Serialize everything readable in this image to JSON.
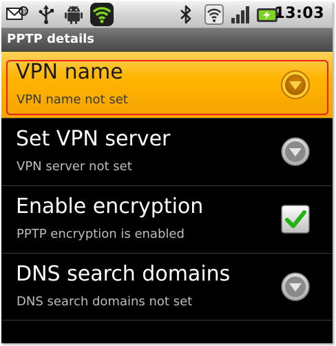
{
  "status_bar": {
    "time": "13:03",
    "icons": [
      "mail-sync-icon",
      "usb-icon",
      "android-debug-icon",
      "wifi-icon",
      "bluetooth-icon",
      "wifi-signal-icon",
      "cell-signal-icon",
      "battery-charging-icon"
    ]
  },
  "header": {
    "title": "PPTP details"
  },
  "prefs": [
    {
      "title": "VPN name",
      "summary": "VPN name not set",
      "control": "dropdown",
      "selected": true
    },
    {
      "title": "Set VPN server",
      "summary": "VPN server not set",
      "control": "dropdown",
      "selected": false
    },
    {
      "title": "Enable encryption",
      "summary": "PPTP encryption is enabled",
      "control": "checkbox",
      "checked": true
    },
    {
      "title": "DNS search domains",
      "summary": "DNS search domains not set",
      "control": "dropdown",
      "selected": false
    }
  ],
  "colors": {
    "highlight": "#ffb400",
    "highlight_outline": "#e8201e",
    "checkmark": "#22b414",
    "wifi_green": "#7ed321"
  }
}
